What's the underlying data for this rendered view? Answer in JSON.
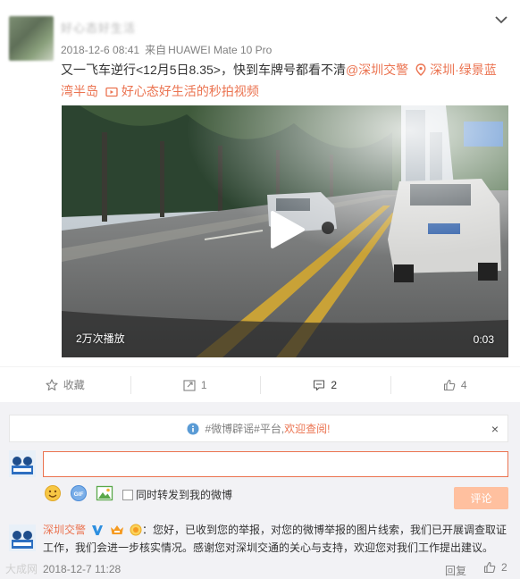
{
  "post": {
    "author_name": "好心态好生活",
    "meta": {
      "date": "2018-12-6 08:41",
      "source_prefix": "来自",
      "device": "HUAWEI Mate 10 Pro"
    },
    "text_main": "又一飞车逆行<12月5日8.35>，快到车牌号都看不清",
    "mention": "@深圳交警",
    "location": "深圳·绿景蓝湾半岛",
    "video_link": "好心态好生活的秒拍视频"
  },
  "video": {
    "views": "2万次播放",
    "duration": "0:03"
  },
  "actions": {
    "favorite_label": "收藏",
    "forward_count": "1",
    "comment_count": "2",
    "like_count": "4"
  },
  "comment_panel": {
    "notice_gray": "#微博辟谣#平台,",
    "notice_link": "欢迎查阅!",
    "notice_close": "×",
    "input_value": "",
    "forward_label": "同时转发到我的微博",
    "submit_label": "评论"
  },
  "reply": {
    "name": "深圳交警",
    "text": "：您好，已收到您的举报，对您的微博举报的图片线索，我们已开展调查取证工作，我们会进一步核实情况。感谢您对深圳交通的关心与支持，欢迎您对我们工作提出建议。",
    "time": "2018-12-7 11:28",
    "reply_label": "回复",
    "like_count": "2"
  },
  "watermark": "大成网",
  "colors": {
    "accent": "#eb7350",
    "submit_disabled": "#ffc09f",
    "meta_gray": "#808080",
    "panel_bg": "#f2f2f5"
  },
  "icons": [
    "chevron-down-icon",
    "location-pin-icon",
    "video-icon",
    "play-icon",
    "star-icon",
    "forward-icon",
    "comment-icon",
    "like-icon",
    "info-icon",
    "emoji-icon",
    "gif-icon",
    "image-icon",
    "verified-icon"
  ]
}
